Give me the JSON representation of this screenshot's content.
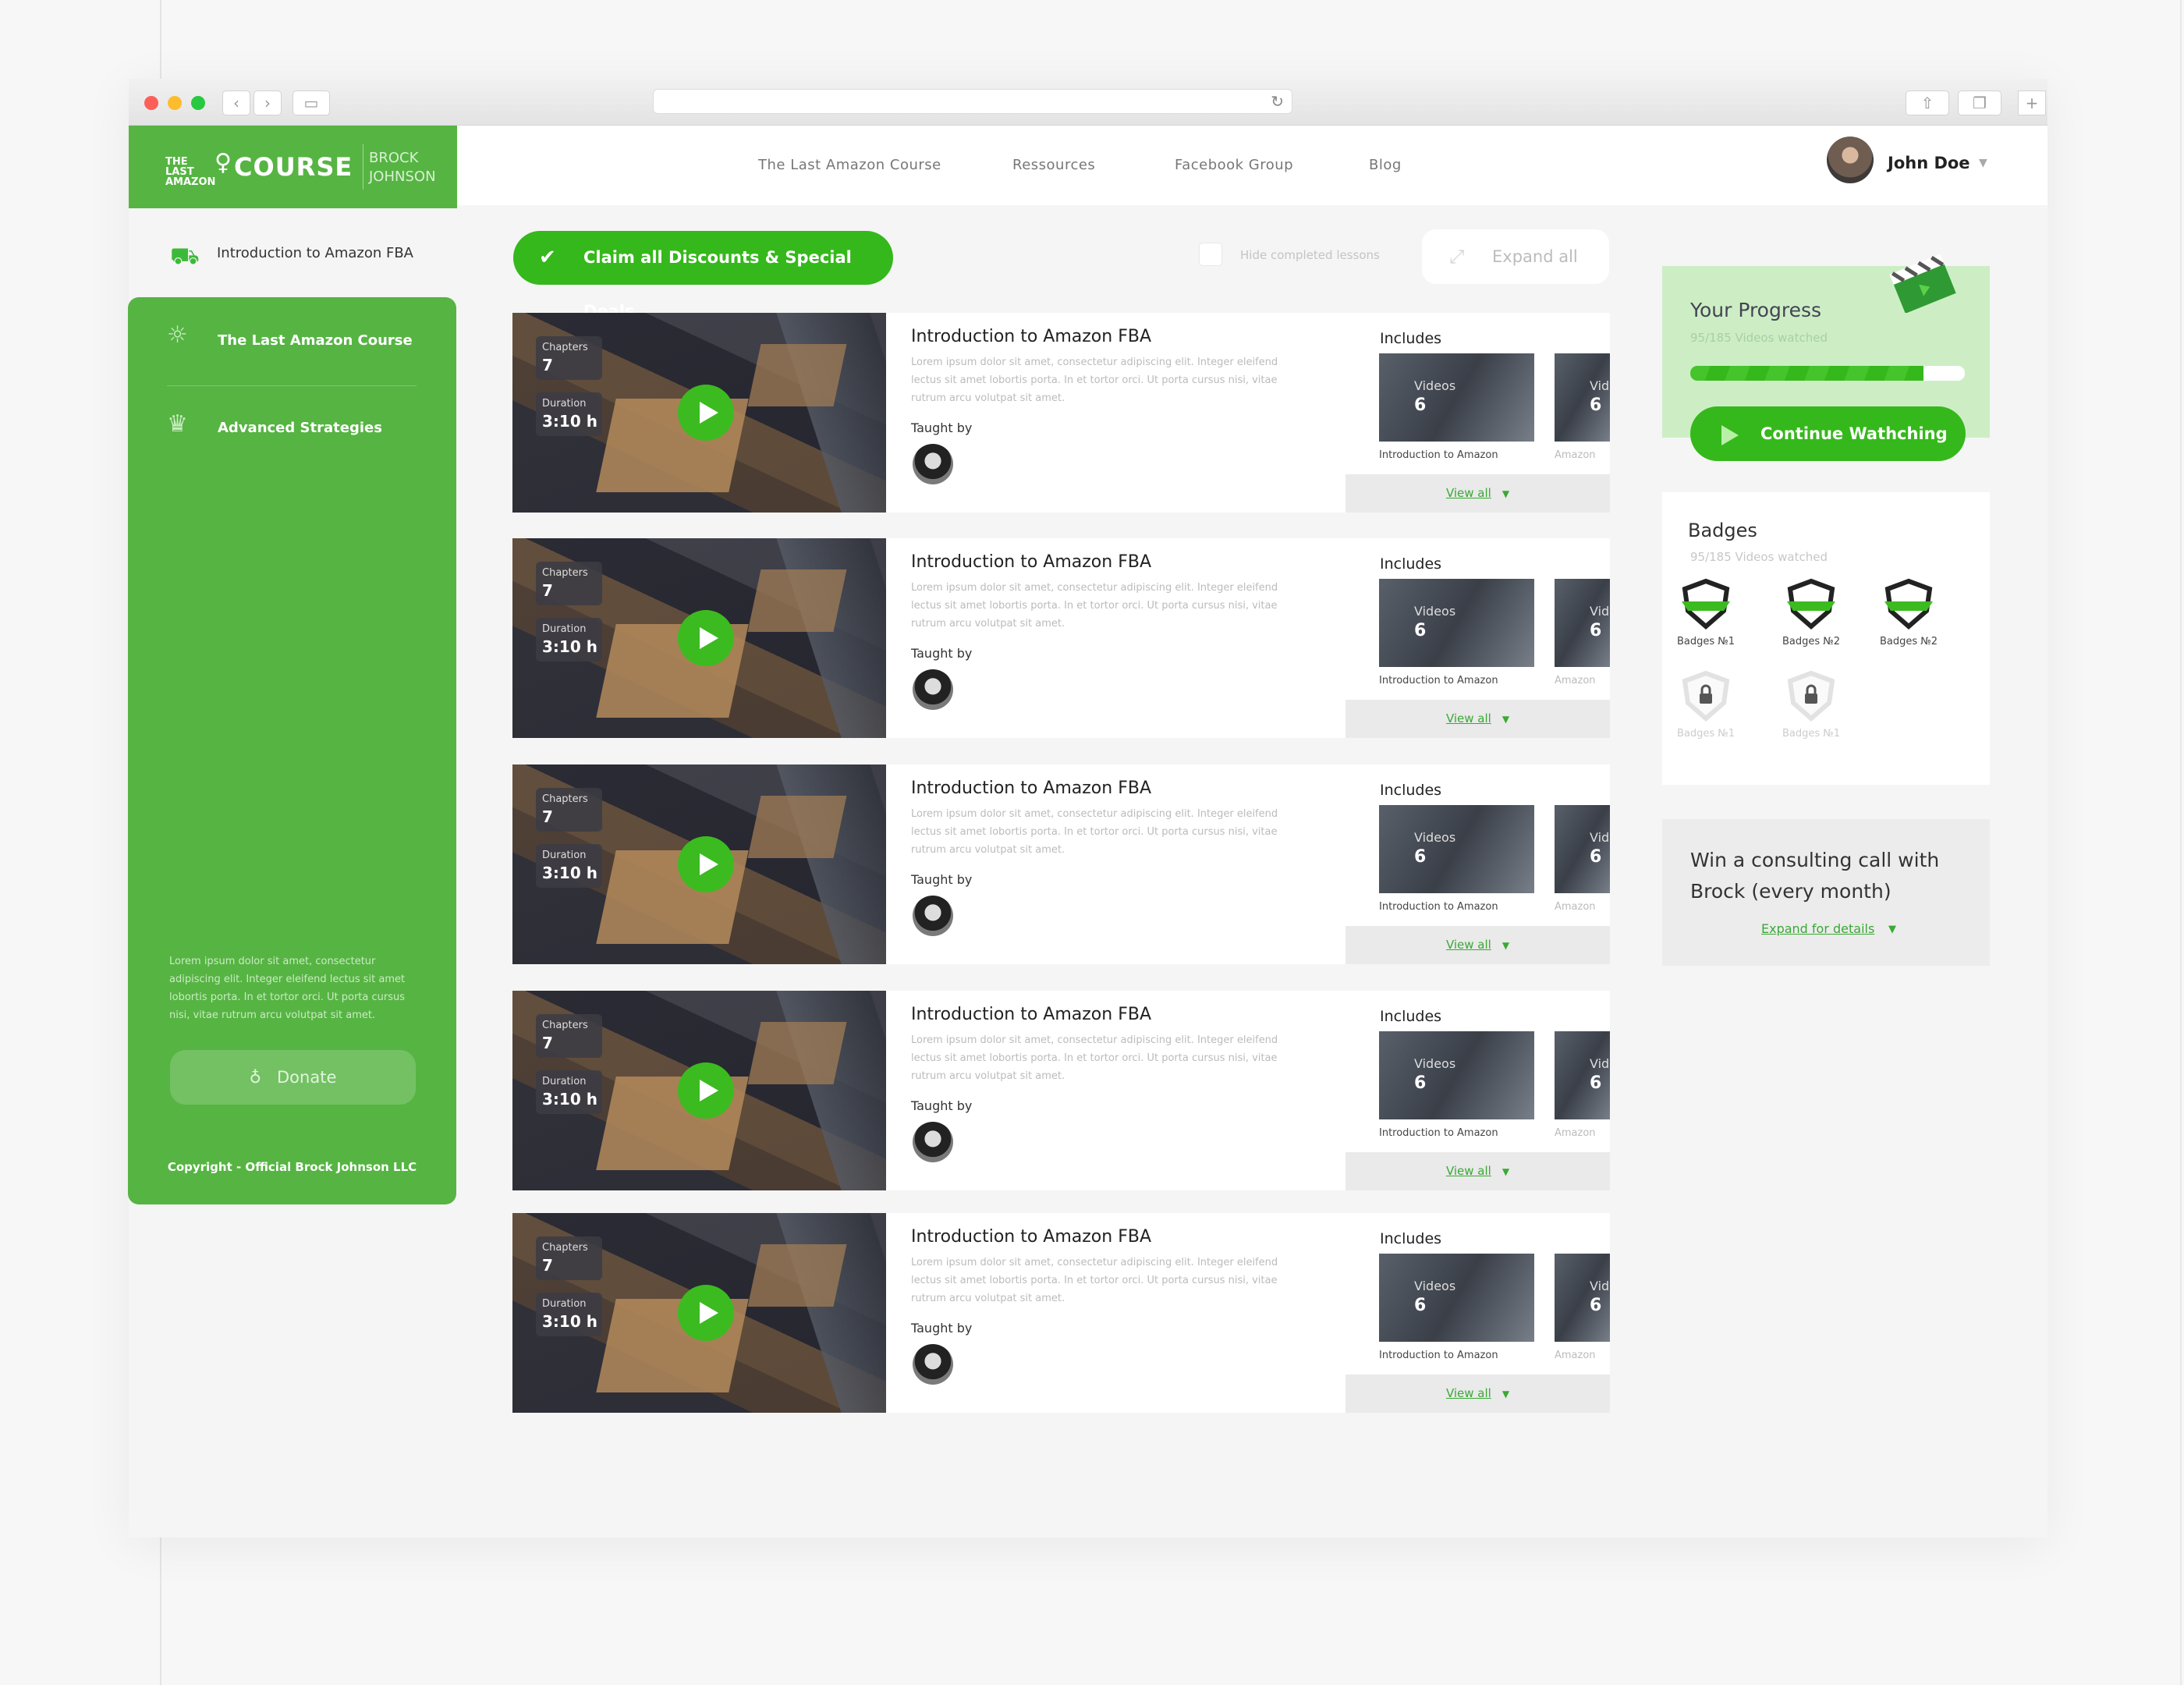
{
  "header": {
    "logo_small": "THE LAST AMAZON",
    "logo_big": "COURSE",
    "logo_author": "BROCK JOHNSON",
    "nav": [
      "The Last Amazon Course",
      "Ressources",
      "Facebook Group",
      "Blog"
    ],
    "user_name": "John Doe"
  },
  "sidebar": {
    "intro": "Introduction to Amazon FBA",
    "items": [
      "The Last Amazon Course",
      "Advanced Strategies"
    ],
    "lorem": "Lorem ipsum dolor sit amet, consectetur adipiscing elit. Integer eleifend lectus sit amet lobortis porta. In et tortor orci. Ut porta cursus nisi, vitae rutrum arcu volutpat sit amet.",
    "donate": "Donate",
    "copyright": "Copyright - Official Brock Johnson LLC"
  },
  "toolbar": {
    "claim": "Claim all Discounts & Special Deals",
    "hide_completed": "Hide completed lessons",
    "expand_all": "Expand all"
  },
  "lesson_common": {
    "chapters_label": "Chapters",
    "chapters_value": "7",
    "duration_label": "Duration",
    "duration_value": "3:10 h",
    "title": "Introduction to Amazon FBA",
    "desc": "Lorem ipsum dolor sit amet, consectetur adipiscing elit. Integer eleifend lectus sit amet lobortis porta. In et tortor orci. Ut porta cursus nisi, vitae rutrum arcu volutpat sit amet.",
    "taught_by": "Taught by",
    "includes": "Includes",
    "video_label": "Videos",
    "video_label_cut": "Vid",
    "video_value": "6",
    "video_caption": "Introduction to Amazon",
    "video_caption2": "Amazon",
    "view_all": "View all"
  },
  "progress": {
    "title": "Your Progress",
    "subtitle": "95/185 Videos watched",
    "fraction": 0.85,
    "continue": "Continue Wathching"
  },
  "badges": {
    "title": "Badges",
    "subtitle": "95/185 Videos watched",
    "items": [
      {
        "label": "Badges №1",
        "locked": false
      },
      {
        "label": "Badges №2",
        "locked": false
      },
      {
        "label": "Badges №2",
        "locked": false
      },
      {
        "label": "Badges №1",
        "locked": true
      },
      {
        "label": "Badges №1",
        "locked": true
      }
    ]
  },
  "consult": {
    "title": "Win a consulting call with Brock (every month)",
    "expand": "Expand for details"
  },
  "colors": {
    "brand_green": "#56b443",
    "accent_green": "#35b81b"
  }
}
